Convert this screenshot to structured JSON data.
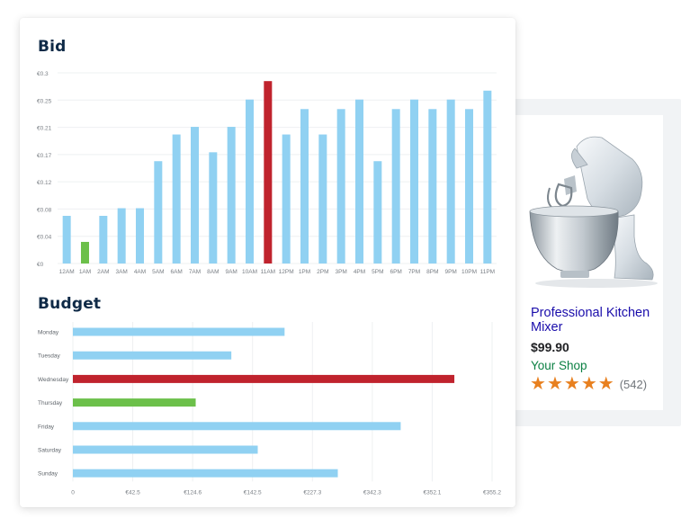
{
  "colors": {
    "bar": "#90d1f2",
    "highlight": "#c0232d",
    "low": "#6cc04a",
    "title": "#0f2a47",
    "star": "#e8801f"
  },
  "chart_data": [
    {
      "type": "bar",
      "title": "Bid",
      "orientation": "vertical",
      "categories": [
        "12AM",
        "1AM",
        "2AM",
        "3AM",
        "4AM",
        "5AM",
        "6AM",
        "7AM",
        "8AM",
        "9AM",
        "10AM",
        "11AM",
        "12PM",
        "1PM",
        "2PM",
        "3PM",
        "4PM",
        "5PM",
        "6PM",
        "7PM",
        "8PM",
        "9PM",
        "10PM",
        "11PM"
      ],
      "values": [
        0.075,
        0.034,
        0.075,
        0.087,
        0.087,
        0.161,
        0.203,
        0.215,
        0.175,
        0.215,
        0.258,
        0.287,
        0.203,
        0.243,
        0.203,
        0.243,
        0.258,
        0.161,
        0.243,
        0.258,
        0.243,
        0.258,
        0.243,
        0.272
      ],
      "ytick_labels": [
        "€0",
        "€0.04",
        "€0.08",
        "€0.12",
        "€0.17",
        "€0.21",
        "€0.25",
        "€0.3"
      ],
      "ylim": [
        0,
        0.3
      ],
      "grid": true,
      "highlight_index": 11,
      "low_index": 1
    },
    {
      "type": "bar",
      "title": "Budget",
      "orientation": "horizontal",
      "categories": [
        "Monday",
        "Tuesday",
        "Wednesday",
        "Thursday",
        "Friday",
        "Saturday",
        "Sunday"
      ],
      "values": [
        0.505,
        0.378,
        0.91,
        0.293,
        0.782,
        0.441,
        0.632
      ],
      "xtick_labels": [
        "0",
        "€42.5",
        "€124.6",
        "€142.5",
        "€227.3",
        "€342.3",
        "€352.1",
        "€355.2"
      ],
      "grid": true,
      "highlight_index": 2,
      "low_index": 3
    }
  ],
  "product": {
    "image": "stand-mixer-image",
    "name": "Professional Kitchen Mixer",
    "price": "$99.90",
    "shop": "Your Shop",
    "rating": 5,
    "review_count": "(542)"
  }
}
